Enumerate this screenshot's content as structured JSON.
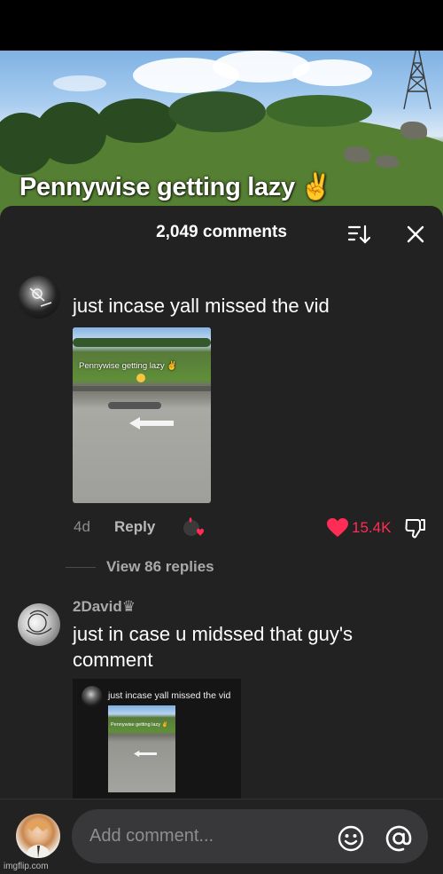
{
  "video": {
    "caption": "Pennywise getting lazy",
    "caption_emoji": "✌️"
  },
  "comments_sheet": {
    "count_label": "2,049 comments",
    "sort_icon": "sort-icon",
    "close_icon": "close-icon"
  },
  "comments": [
    {
      "username": "",
      "text": "just incase yall missed the vid",
      "media": {
        "caption": "Pennywise getting lazy ✌️"
      },
      "time": "4d",
      "reply_label": "Reply",
      "likes": "15.4K",
      "view_replies": "View 86 replies"
    },
    {
      "username": "2David♛",
      "text_line1": "just in case u midssed that guy's",
      "text_line2": "comment",
      "media": {
        "nested_text": "just incase yall missed the vid",
        "nested_caption": "Pennywise getting lazy ✌️"
      }
    }
  ],
  "composer": {
    "placeholder": "Add comment...",
    "emoji_icon": "emoji-icon",
    "mention_icon": "mention-icon"
  },
  "watermark": "imgflip.com",
  "colors": {
    "sheet_bg": "#222223",
    "like_red": "#ff2d55",
    "muted_text": "#a9a9ab"
  }
}
